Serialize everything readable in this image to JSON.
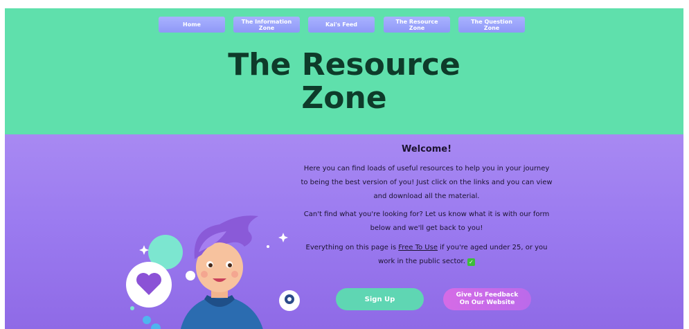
{
  "nav": {
    "items": [
      {
        "label": "Home"
      },
      {
        "label": "The Information\nZone"
      },
      {
        "label": "Kai's Feed"
      },
      {
        "label": "The Resource\nZone"
      },
      {
        "label": "The Question\nZone"
      }
    ]
  },
  "hero": {
    "title": "The Resource\nZone"
  },
  "main": {
    "heading": "Welcome!",
    "paragraph1": "Here you can find loads of useful resources to help you in your journey to being the best version of you! Just click on the links and you can view and download all the material.",
    "paragraph2": "Can't find what you're looking for? Let us know what it is with our form below and we'll get back to you!",
    "paragraph3_before": "Everything on this page is ",
    "paragraph3_link": "Free To Use",
    "paragraph3_after": " if you're aged under 25, or you work in the public sector.",
    "check_glyph": "✓"
  },
  "buttons": {
    "signup": "Sign Up",
    "feedback": "Give Us Feedback\nOn Our Website"
  },
  "colors": {
    "hero_bg": "#5fe0ac",
    "content_bg": "#9b7bf0",
    "nav_button": "#9aa3fb",
    "title_text": "#0e3b2a",
    "signup_button": "#5fd6b3",
    "feedback_button": "#c86be8"
  }
}
